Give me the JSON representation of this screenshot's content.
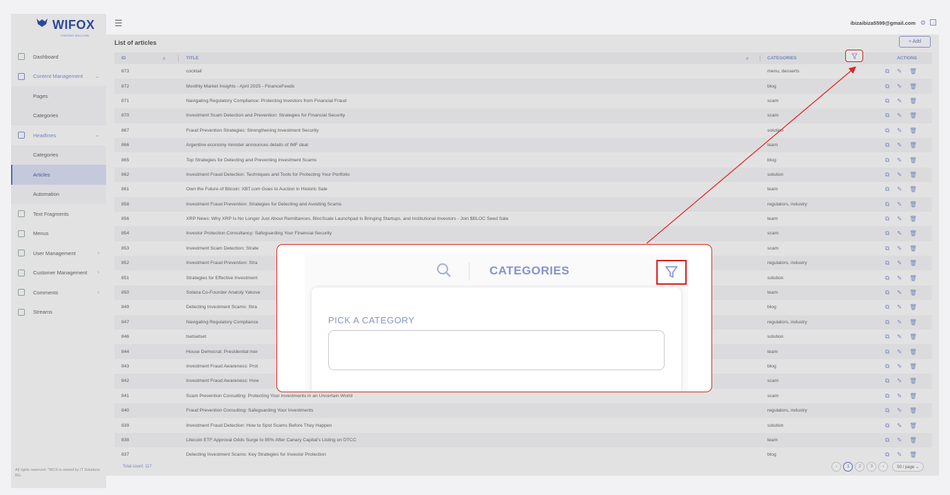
{
  "brand": {
    "name": "WIFOX",
    "tagline": "CONTENT SOLUTION",
    "accent": "#2b4fb3"
  },
  "sidebar": {
    "items": [
      {
        "label": "Dashboard",
        "icon": "grid-icon",
        "type": "item"
      },
      {
        "label": "Content Management",
        "icon": "content-icon",
        "type": "section",
        "chevron": "⌄"
      },
      {
        "label": "Pages",
        "type": "sub"
      },
      {
        "label": "Categories",
        "type": "sub"
      },
      {
        "label": "Headlines",
        "icon": "headlines-icon",
        "type": "section",
        "chevron": "⌄"
      },
      {
        "label": "Categories",
        "type": "sub"
      },
      {
        "label": "Articles",
        "type": "sub",
        "active": true
      },
      {
        "label": "Automation",
        "type": "sub"
      },
      {
        "label": "Text Fragments",
        "icon": "text-icon",
        "type": "item"
      },
      {
        "label": "Menus",
        "icon": "menu-icon",
        "type": "item"
      },
      {
        "label": "User Management",
        "icon": "users-icon",
        "type": "item",
        "chevron": "›"
      },
      {
        "label": "Customer Management",
        "icon": "customer-icon",
        "type": "item",
        "chevron": "›"
      },
      {
        "label": "Comments",
        "icon": "comments-icon",
        "type": "item",
        "chevron": "›"
      },
      {
        "label": "Streams",
        "icon": "streams-icon",
        "type": "item"
      }
    ],
    "footer": "All rights reserved. \"WCS is owned by IT Solutions BG."
  },
  "header": {
    "user_email": "ibizaibiza5599@gmail.com"
  },
  "page": {
    "title": "List of articles",
    "add_label": "+ Add"
  },
  "table": {
    "columns": {
      "id": "ID",
      "title": "TITLE",
      "categories": "CATEGORIES",
      "actions": "ACTIONS"
    },
    "rows": [
      {
        "id": "873",
        "title": "cocktail",
        "categories": "menu, desserts"
      },
      {
        "id": "872",
        "title": "Monthly Market Insights - April 2025 - FinanceFeeds",
        "categories": "blog"
      },
      {
        "id": "871",
        "title": "Navigating Regulatory Compliance: Protecting Investors from Financial Fraud",
        "categories": "scam"
      },
      {
        "id": "870",
        "title": "Investment Scam Detection and Prevention: Strategies for Financial Security",
        "categories": "scam"
      },
      {
        "id": "867",
        "title": "Fraud Prevention Strategies: Strengthening Investment Security",
        "categories": "solution"
      },
      {
        "id": "866",
        "title": "Argentine economy minister announces details of IMF deal",
        "categories": "team"
      },
      {
        "id": "865",
        "title": "Top Strategies for Detecting and Preventing Investment Scams",
        "categories": "blog"
      },
      {
        "id": "862",
        "title": "Investment Fraud Detection: Techniques and Tools for Protecting Your Portfolio",
        "categories": "solution"
      },
      {
        "id": "861",
        "title": "Own the Future of Bitcoin: XBT.com Goes to Auction in Historic Sale",
        "categories": "team"
      },
      {
        "id": "858",
        "title": "Investment Fraud Prevention: Strategies for Detecting and Avoiding Scams",
        "categories": "regulators, industry"
      },
      {
        "id": "856",
        "title": "XRP News: Why XRP Is No Longer Just About Remittances, BlocScale Launchpad Is Bringing Startups, and Institutional Investors - Join $BLOC Seed Sale",
        "categories": "team"
      },
      {
        "id": "854",
        "title": "Investor Protection Consultancy: Safeguarding Your Financial Security",
        "categories": "scam"
      },
      {
        "id": "853",
        "title": "Investment Scam Detection: Strate",
        "categories": "scam"
      },
      {
        "id": "852",
        "title": "Investment Fraud Prevention: Stra",
        "categories": "regulators, industry"
      },
      {
        "id": "851",
        "title": "Strategies for Effective Investment",
        "categories": "solution"
      },
      {
        "id": "850",
        "title": "Solana Co-Founder Anatoly Yakove",
        "categories": "team"
      },
      {
        "id": "849",
        "title": "Detecting Investment Scams: Stra",
        "categories": "blog"
      },
      {
        "id": "847",
        "title": "Navigating Regulatory Compliance",
        "categories": "regulators, industry"
      },
      {
        "id": "846",
        "title": "tsetsetset",
        "categories": "solution"
      },
      {
        "id": "844",
        "title": "House Democrat: Presidential mer",
        "categories": "team"
      },
      {
        "id": "843",
        "title": "Investment Fraud Awareness: Prot",
        "categories": "blog"
      },
      {
        "id": "842",
        "title": "Investment Fraud Awareness: How",
        "categories": "scam"
      },
      {
        "id": "841",
        "title": "Scam Prevention Consulting: Protecting Your Investments in an Uncertain World",
        "categories": "scam"
      },
      {
        "id": "840",
        "title": "Fraud Prevention Consulting: Safeguarding Your Investments",
        "categories": "regulators, industry"
      },
      {
        "id": "839",
        "title": "Investment Fraud Detection: How to Spot Scams Before They Happen",
        "categories": "solution"
      },
      {
        "id": "838",
        "title": "Litecoin ETF Approval Odds Surge to 85% After Canary Capital's Listing on DTCC",
        "categories": "team"
      },
      {
        "id": "837",
        "title": "Detecting Investment Scams: Key Strategies for Investor Protection",
        "categories": "blog"
      }
    ],
    "total": "Total count: 117"
  },
  "pagination": {
    "prev": "‹",
    "pages": [
      "1",
      "2",
      "3"
    ],
    "next": "›",
    "page_size": "50 / page ⌄"
  },
  "callout": {
    "header_label": "CATEGORIES",
    "popover_label": "PICK A CATEGORY",
    "highlight_color": "#e02424"
  }
}
